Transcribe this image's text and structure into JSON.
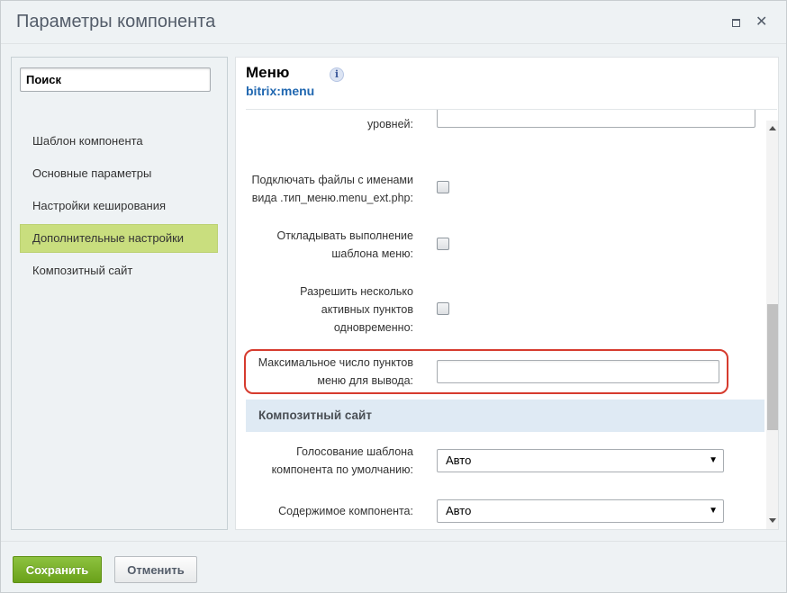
{
  "window": {
    "title": "Параметры компонента"
  },
  "sidebar": {
    "search_value": "Поиск",
    "items": [
      {
        "label": "Шаблон компонента"
      },
      {
        "label": "Основные параметры"
      },
      {
        "label": "Настройки кеширования"
      },
      {
        "label": "Дополнительные настройки",
        "active": true
      },
      {
        "label": "Композитный сайт"
      }
    ]
  },
  "component": {
    "name": "Меню",
    "code": "bitrix:menu",
    "info_icon": "i"
  },
  "params": {
    "cut_label": "уровней:",
    "include_files_label_1": "Подключать файлы с именами",
    "include_files_label_2": "вида .тип_меню.menu_ext.php:",
    "include_files_checked": false,
    "defer_label_1": "Откладывать выполнение",
    "defer_label_2": "шаблона меню:",
    "defer_checked": false,
    "multi_active_label_1": "Разрешить несколько",
    "multi_active_label_2": "активных пунктов",
    "multi_active_label_3": "одновременно:",
    "multi_active_checked": false,
    "max_items_label_1": "Максимальное число пунктов",
    "max_items_label_2": "меню для вывода:",
    "max_items_value": ""
  },
  "composite": {
    "section_title": "Композитный сайт",
    "voting_label_1": "Голосование шаблона",
    "voting_label_2": "компонента по умолчанию:",
    "voting_value": "Авто",
    "content_label": "Содержимое компонента:",
    "content_value": "Авто"
  },
  "footer": {
    "save_label": "Сохранить",
    "cancel_label": "Отменить"
  },
  "colors": {
    "save_button": "#7ab12b",
    "active_nav": "#c9de7e",
    "section_band": "#dfeaf4",
    "highlight": "#d63b2e",
    "link": "#2067b0"
  }
}
